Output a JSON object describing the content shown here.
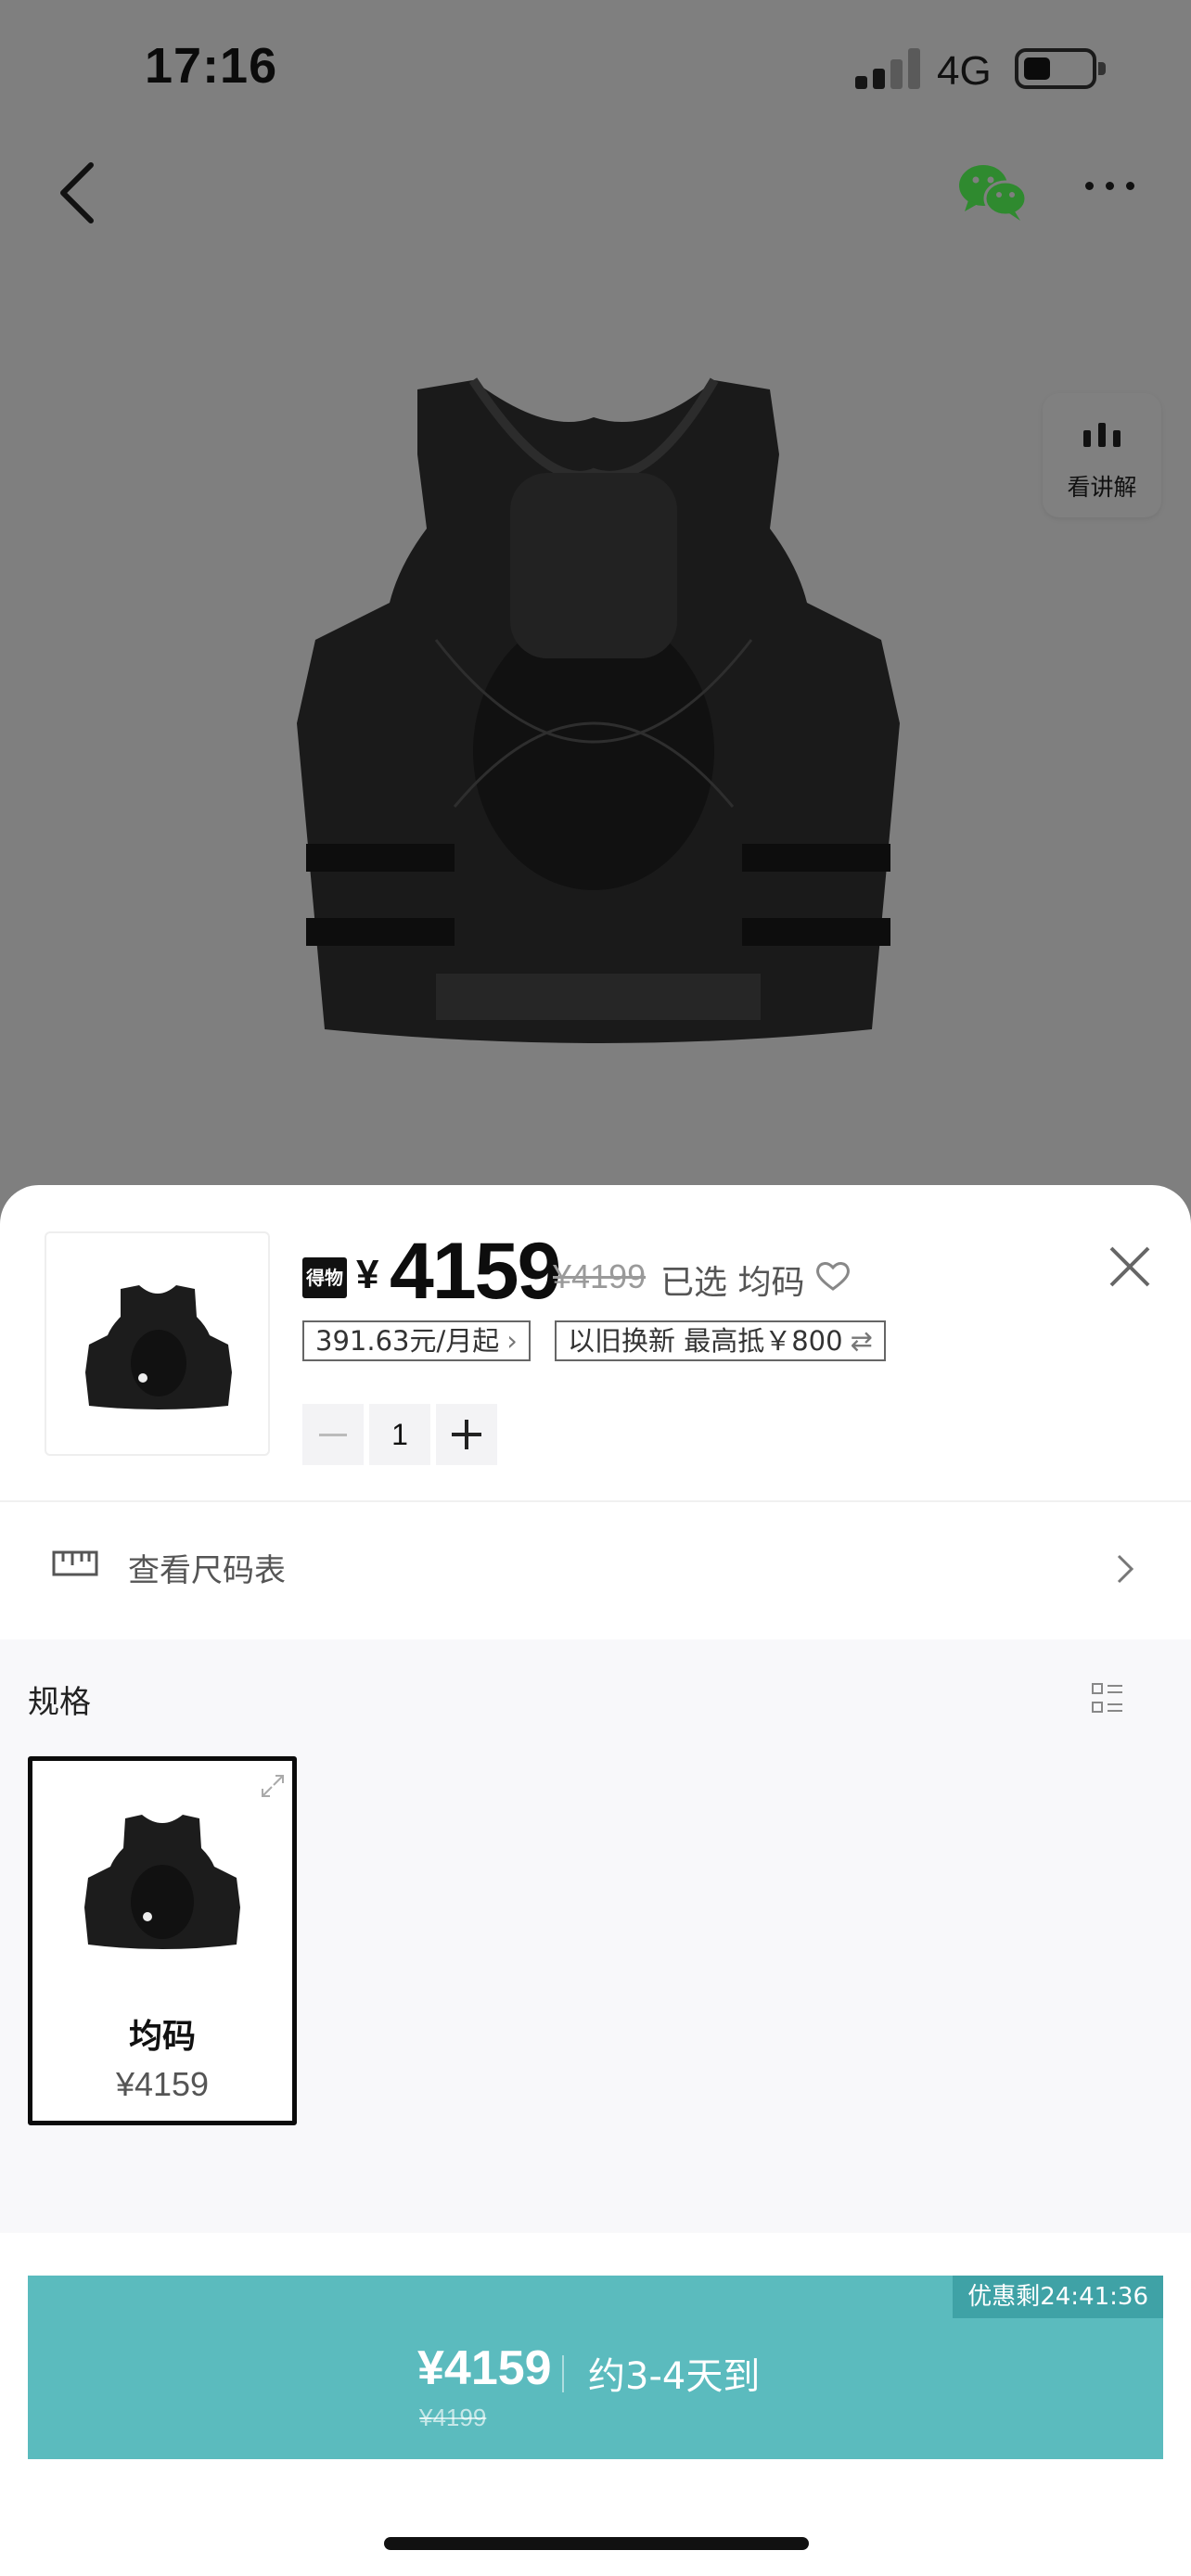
{
  "status_bar": {
    "time": "17:16",
    "network": "4G"
  },
  "explain_button": {
    "label": "看讲解"
  },
  "product": {
    "badge": "得物",
    "currency": "¥",
    "price": "4159",
    "original_price": "¥4199",
    "selected_text": "已选 均码",
    "installment_tag": "391.63元/月起",
    "tradein_tag": "以旧换新 最高抵￥800",
    "quantity": "1"
  },
  "size_chart": {
    "label": "查看尺码表"
  },
  "spec": {
    "title": "规格",
    "options": [
      {
        "name": "均码",
        "price": "¥4159"
      }
    ]
  },
  "buy_button": {
    "price": "¥4159",
    "original_price": "¥4199",
    "eta": "约3-4天到",
    "coupon": "优惠剩24:41:36"
  },
  "colors": {
    "accent": "#5bbbbe",
    "coupon_bg": "#3fa2a6",
    "overlay": "#7f7f7f"
  }
}
